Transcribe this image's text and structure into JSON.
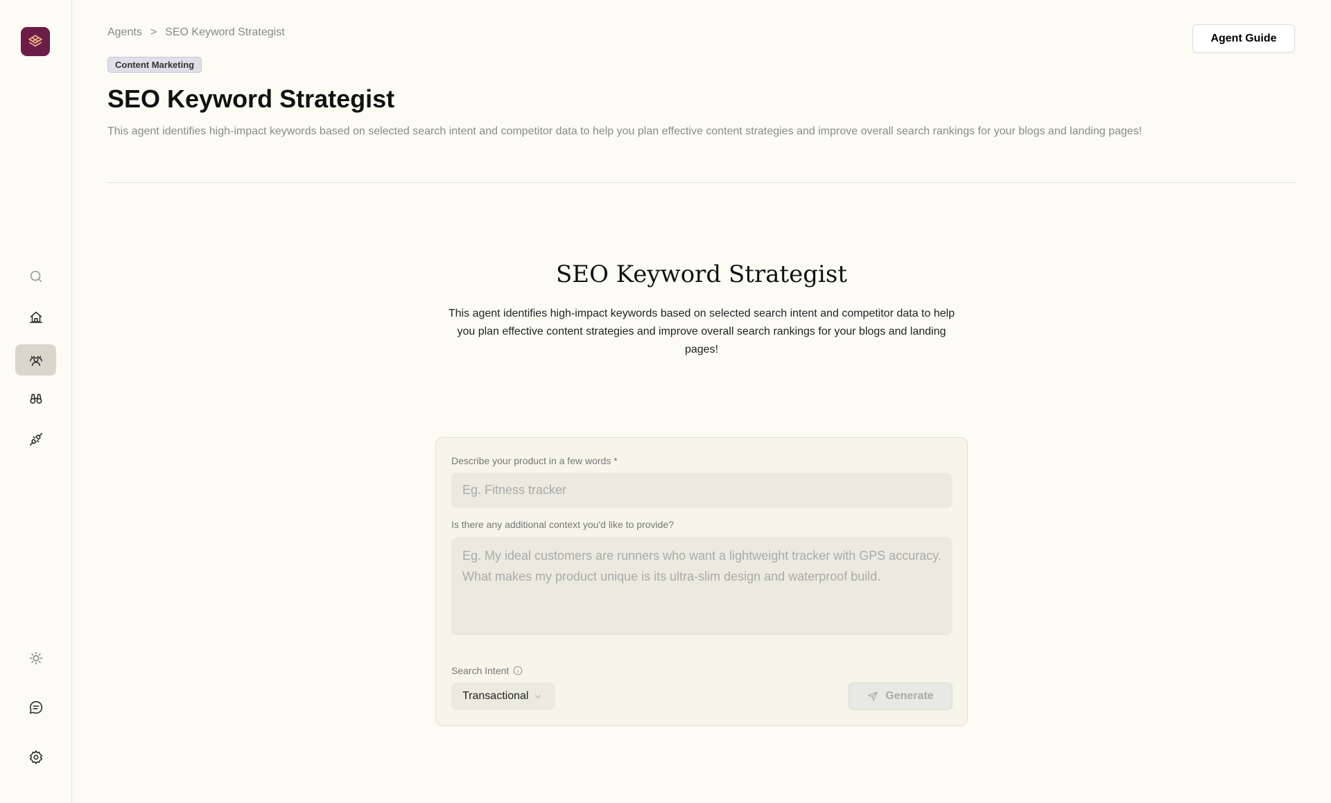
{
  "sidebar": {
    "active": "agents",
    "top_icons": [
      "search-icon",
      "home-icon",
      "agents-icon",
      "binoculars-icon",
      "plug-icon"
    ],
    "bottom_icons": [
      "sun-icon",
      "chat-icon",
      "gear-icon"
    ]
  },
  "breadcrumb": {
    "root": "Agents",
    "separator": ">",
    "current": "SEO Keyword Strategist"
  },
  "header": {
    "badge": "Content Marketing",
    "title": "SEO Keyword Strategist",
    "description": "This agent identifies high-impact keywords based on selected search intent and competitor data to help you plan effective content strategies and improve overall search rankings for your blogs and landing pages!",
    "guide_button": "Agent Guide"
  },
  "main": {
    "title": "SEO Keyword Strategist",
    "description": "This agent identifies high-impact keywords based on selected search intent and competitor data to help you plan effective content strategies and improve overall search rankings for your blogs and landing pages!"
  },
  "form": {
    "product_label": "Describe your product in a few words *",
    "product_placeholder": "Eg. Fitness tracker",
    "product_value": "",
    "context_label": "Is there any additional context you'd like to provide?",
    "context_placeholder": "Eg. My ideal customers are runners who want a lightweight tracker with GPS accuracy. What makes my product unique is its ultra-slim design and waterproof build.",
    "context_value": "",
    "intent_label": "Search Intent",
    "intent_value": "Transactional",
    "generate_label": "Generate"
  },
  "colors": {
    "brand": "#6b1d48",
    "background": "#fcfbf4"
  }
}
